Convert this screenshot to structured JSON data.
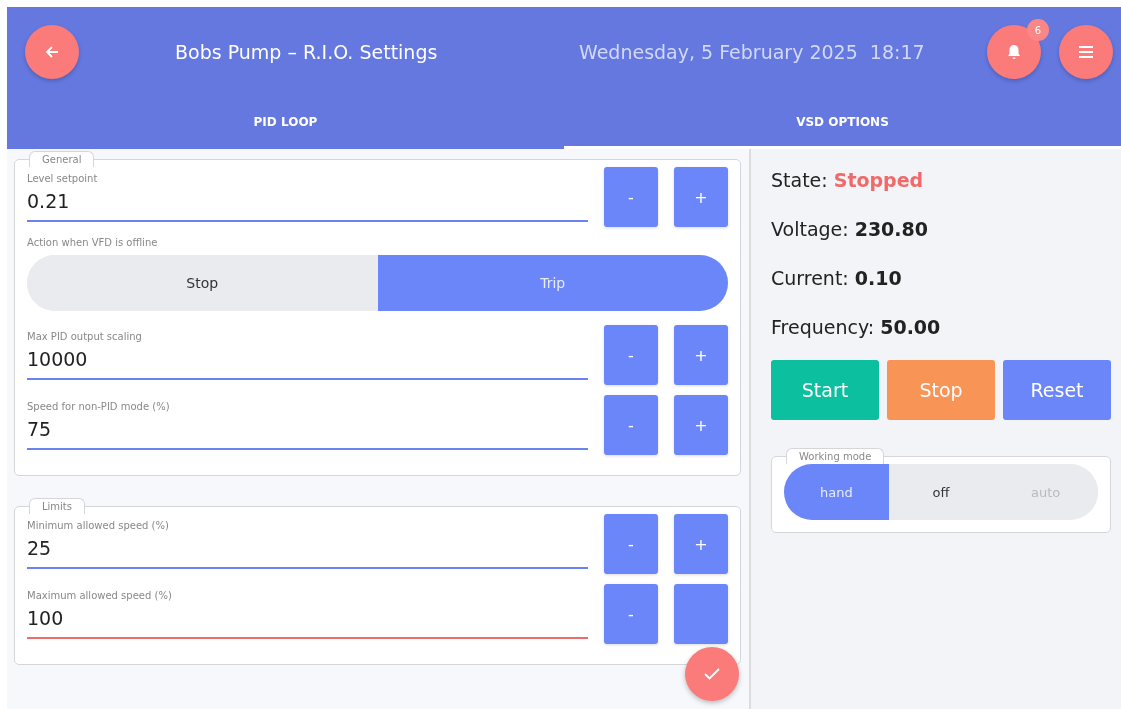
{
  "header": {
    "title": "Bobs Pump – R.I.O. Settings",
    "datetime": "Wednesday, 5 February 2025  18:17",
    "notification_count": "6"
  },
  "tabs": [
    {
      "label": "PID LOOP",
      "selected": false
    },
    {
      "label": "VSD OPTIONS",
      "selected": true
    }
  ],
  "sections": [
    {
      "legend": "General",
      "items": [
        {
          "kind": "stepper",
          "label": "Level setpoint",
          "value": "0.21",
          "invalid": false,
          "decrement": "-",
          "increment": "+"
        },
        {
          "kind": "toggle",
          "label": "Action when VFD is offline",
          "options": [
            {
              "label": "Stop",
              "selected": false
            },
            {
              "label": "Trip",
              "selected": true
            }
          ]
        },
        {
          "kind": "stepper",
          "label": "Max PID output scaling",
          "value": "10000",
          "invalid": false,
          "decrement": "-",
          "increment": "+"
        },
        {
          "kind": "stepper",
          "label": "Speed for non-PID mode (%)",
          "value": "75",
          "invalid": false,
          "decrement": "-",
          "increment": "+"
        }
      ]
    },
    {
      "legend": "Limits",
      "items": [
        {
          "kind": "stepper",
          "label": "Minimum allowed speed (%)",
          "value": "25",
          "invalid": false,
          "decrement": "-",
          "increment": "+"
        },
        {
          "kind": "stepper",
          "label": "Maximum allowed speed (%)",
          "value": "100",
          "invalid": true,
          "decrement": "-"
        }
      ]
    }
  ],
  "status": [
    {
      "label": "State:",
      "value": "Stopped",
      "alarm": true
    },
    {
      "label": "Voltage:",
      "value": "230.80",
      "alarm": false
    },
    {
      "label": "Current:",
      "value": "0.10",
      "alarm": false
    },
    {
      "label": "Frequency:",
      "value": "50.00",
      "alarm": false
    }
  ],
  "actions": [
    {
      "label": "Start",
      "kind": "start"
    },
    {
      "label": "Stop",
      "kind": "stop"
    },
    {
      "label": "Reset",
      "kind": "reset"
    }
  ],
  "working_mode": {
    "legend": "Working mode",
    "options": [
      {
        "label": "hand",
        "selected": true,
        "disabled": false
      },
      {
        "label": "off",
        "selected": false,
        "disabled": false
      },
      {
        "label": "auto",
        "selected": false,
        "disabled": true
      }
    ]
  }
}
